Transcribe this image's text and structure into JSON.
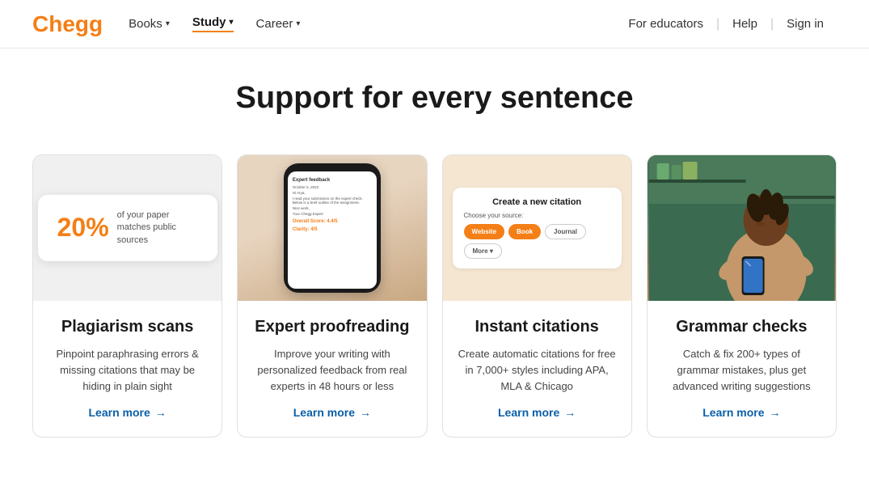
{
  "logo": {
    "text": "Chegg"
  },
  "nav": {
    "links": [
      {
        "label": "Books",
        "chevron": "▾",
        "active": false
      },
      {
        "label": "Study",
        "chevron": "▾",
        "active": true
      },
      {
        "label": "Career",
        "chevron": "▾",
        "active": false
      }
    ],
    "right_links": [
      {
        "label": "For educators"
      },
      {
        "label": "Help"
      },
      {
        "label": "Sign in"
      }
    ]
  },
  "headline": "Support for every sentence",
  "cards": [
    {
      "id": "plagiarism",
      "percent": "20%",
      "percent_desc": "of your paper matches public sources",
      "title": "Plagiarism scans",
      "description": "Pinpoint paraphrasing errors & missing citations that may be hiding in plain sight",
      "learn_more": "Learn more"
    },
    {
      "id": "proofreading",
      "title": "Expert proofreading",
      "description": "Improve your writing with personalized feedback from real experts in 48 hours or less",
      "learn_more": "Learn more",
      "phone_title": "Expert feedback",
      "phone_lines": [
        "Hi Arya,",
        "I read your submission...",
        "Below is a brief outline..."
      ],
      "phone_score": "Overall Score: 4.4/5",
      "phone_clarity": "Clarity: 4/5"
    },
    {
      "id": "citations",
      "title": "Instant citations",
      "description": "Create automatic citations for free in 7,000+ styles including APA, MLA & Chicago",
      "learn_more": "Learn more",
      "citation_title": "Create a new citation",
      "citation_subtitle": "Choose your source:",
      "citation_buttons": [
        {
          "label": "Website",
          "style": "orange"
        },
        {
          "label": "Book",
          "style": "orange"
        },
        {
          "label": "Journal",
          "style": "outline"
        },
        {
          "label": "More ▾",
          "style": "outline"
        }
      ]
    },
    {
      "id": "grammar",
      "title": "Grammar checks",
      "description": "Catch & fix 200+ types of grammar mistakes, plus get advanced writing suggestions",
      "learn_more": "Learn more"
    }
  ]
}
